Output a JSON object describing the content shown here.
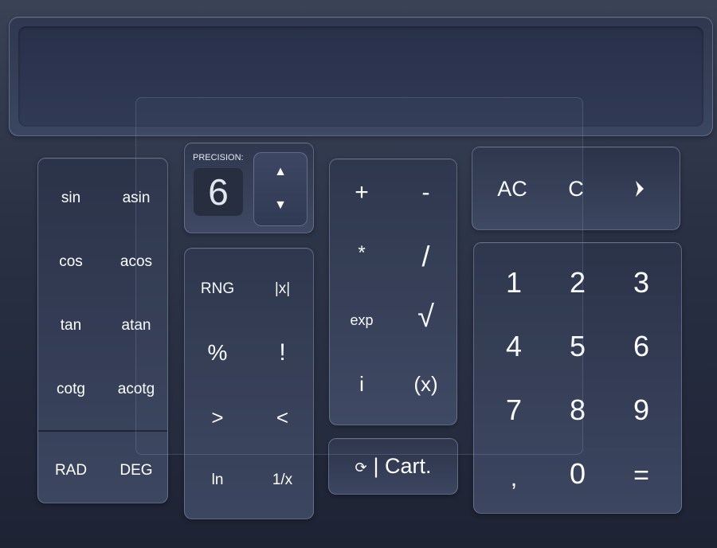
{
  "display": {
    "value": ""
  },
  "precision": {
    "label": "PRECISION:",
    "value": "6",
    "up_icon": "triangle-up",
    "down_icon": "triangle-down"
  },
  "trig": {
    "keys": [
      "sin",
      "asin",
      "cos",
      "acos",
      "tan",
      "atan",
      "cotg",
      "acotg"
    ]
  },
  "angle": {
    "rad": "RAD",
    "deg": "DEG"
  },
  "functions": {
    "keys": [
      "RNG",
      "|x|",
      "%",
      "!",
      ">",
      "<",
      "ln",
      "1/x"
    ]
  },
  "operators": {
    "keys": [
      "+",
      "-",
      "*",
      "/",
      "exp",
      "√",
      "i",
      "(x)"
    ]
  },
  "mode": {
    "icon": "cycle-icon",
    "label": "| Cart."
  },
  "clear": {
    "ac": "AC",
    "c": "C",
    "backspace_icon": "backspace-arrow"
  },
  "numpad": {
    "keys": [
      "1",
      "2",
      "3",
      "4",
      "5",
      "6",
      "7",
      "8",
      "9",
      ",",
      "0",
      "="
    ]
  }
}
